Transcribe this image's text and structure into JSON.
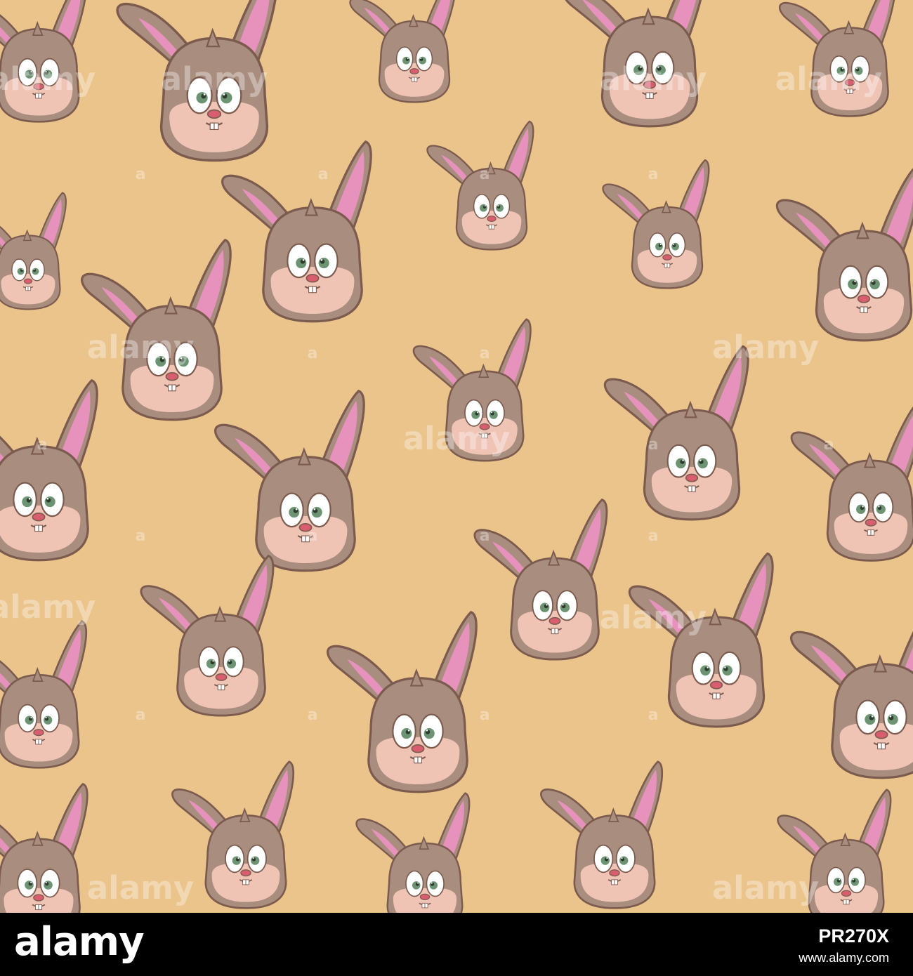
{
  "pattern": {
    "subject": "cartoon rabbit faces",
    "background_color": "#EAC48A",
    "watermark_text": "alamy"
  },
  "footer": {
    "logo_text": "alamy",
    "image_id": "PR270X",
    "url": "www.alamy.com"
  },
  "colors": {
    "fur": "#a98d7e",
    "muzzle": "#efc4b5",
    "inner_ear": "#e692bd",
    "outline": "#7c5b4f",
    "eye": "#6c9372",
    "nose": "#d75d6f"
  }
}
